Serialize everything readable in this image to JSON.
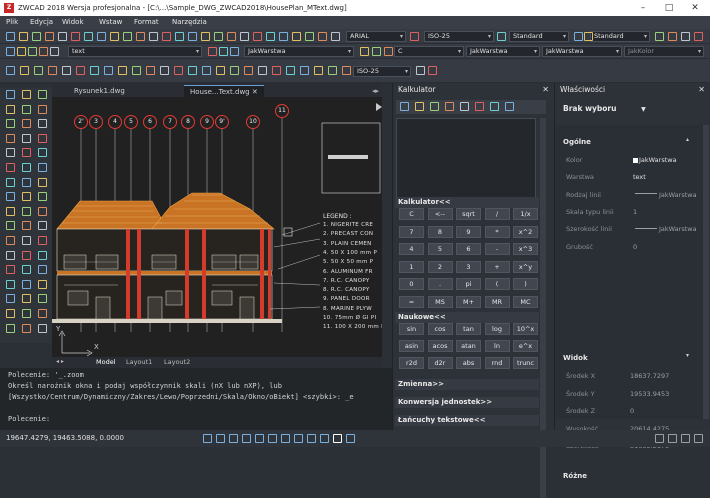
{
  "app": {
    "title": "ZWCAD 2018 Wersja profesjonalna - [C:\\...\\Sample_DWG_ZWCAD2018\\HousePlan_MText.dwg]",
    "logo": "Z"
  },
  "menu": [
    "Plik",
    "Edycja",
    "Widok",
    "Wstaw",
    "Format",
    "Narzędzia"
  ],
  "toolbars": {
    "font": "ARIAL",
    "iso1": "ISO-25",
    "standard1": "Standard",
    "standard2": "Standard",
    "layer": "text",
    "byblock_small": "JakWarstwa",
    "bylayer_c": "C",
    "bylayer1": "JakWarstwa",
    "bylayer2": "JakWarstwa",
    "jakkolor": "JakKolor",
    "iso2": "ISO-25"
  },
  "doc_tabs": [
    {
      "label": "Rysunek1.dwg",
      "active": false
    },
    {
      "label": "House...Text.dwg",
      "active": true
    }
  ],
  "layout_tabs": [
    "Model",
    "Layout1",
    "Layout2"
  ],
  "drawing": {
    "grid_bubbles": [
      "2'",
      "3",
      "4",
      "5",
      "6",
      "7",
      "8",
      "9",
      "9'",
      "10",
      "11"
    ],
    "legend_title": "LEGEND :",
    "legend": [
      "1.  NIGERITE CRE",
      "2.  PRECAST CON",
      "3.  PLAIN CEMEN",
      "4.  50 X 100 mm P",
      "5.  50 X 50 mm P",
      "6.  ALUMINUM FR",
      "7.  R.C. CANOPY",
      "8.  R.C. CANOPY",
      "9.  PANEL DOOR",
      "8.  MARINE PLYW",
      "10.  75mm Ø  GI PI",
      "11.  100 X 200 mm I"
    ],
    "axis_x": "X",
    "axis_y": "Y"
  },
  "command": {
    "lines": [
      "Polecenie: '_.zoom",
      "Określ narożnik okna i podaj współczynnik skali (nX lub nXP), lub",
      "[Wszystko/Centrum/Dynamiczny/Zakres/Lewo/Poprzedni/Skala/Okno/oBiekt] <szybki>: _e"
    ],
    "prompt": "Polecenie:"
  },
  "status": {
    "coords": "19647.4279, 19463.5088, 0.0000"
  },
  "calculator": {
    "title": "Kalkulator",
    "section_calc": "Kalkulator<<",
    "keys": [
      [
        "C",
        "<--",
        "sqrt",
        "/",
        "1/x"
      ],
      [
        "7",
        "8",
        "9",
        "*",
        "x^2"
      ],
      [
        "4",
        "5",
        "6",
        "-",
        "x^3"
      ],
      [
        "1",
        "2",
        "3",
        "+",
        "x^y"
      ],
      [
        "0",
        ".",
        "pi",
        "(",
        ")"
      ],
      [
        "=",
        "MS",
        "M+",
        "MR",
        "MC"
      ]
    ],
    "section_sci": "Naukowe<<",
    "sci_keys": [
      [
        "sin",
        "cos",
        "tan",
        "log",
        "10^x"
      ],
      [
        "asin",
        "acos",
        "atan",
        "ln",
        "e^x"
      ],
      [
        "r2d",
        "d2r",
        "abs",
        "rnd",
        "trunc"
      ]
    ],
    "section_vars": "Zmienna>>",
    "section_conv": "Konwersja jednostek>>",
    "section_text": "Łańcuchy tekstowe<<"
  },
  "properties": {
    "title": "Właściwości",
    "selection": "Brak wyboru",
    "general_title": "Ogólne",
    "general": [
      {
        "label": "Kolor",
        "value": "JakWarstwa"
      },
      {
        "label": "Warstwa",
        "value": "text"
      },
      {
        "label": "Rodzaj linii",
        "value": "JakWarstwa"
      },
      {
        "label": "Skala typu linii",
        "value": "1"
      },
      {
        "label": "Szerokość linii",
        "value": "JakWarstwa"
      },
      {
        "label": "Grubość",
        "value": "0"
      }
    ],
    "view_title": "Widok",
    "view": [
      {
        "label": "Środek X",
        "value": "18637.7297"
      },
      {
        "label": "Środek Y",
        "value": "19533.9453"
      },
      {
        "label": "Środek Z",
        "value": "0"
      },
      {
        "label": "Wysokość",
        "value": "20614.4275"
      },
      {
        "label": "Szerokość",
        "value": "31635.2175"
      }
    ],
    "misc_title": "Różne"
  },
  "colors": {
    "accent": "#e53935",
    "roof": "#d8842a",
    "wall": "#e8e0c8"
  }
}
